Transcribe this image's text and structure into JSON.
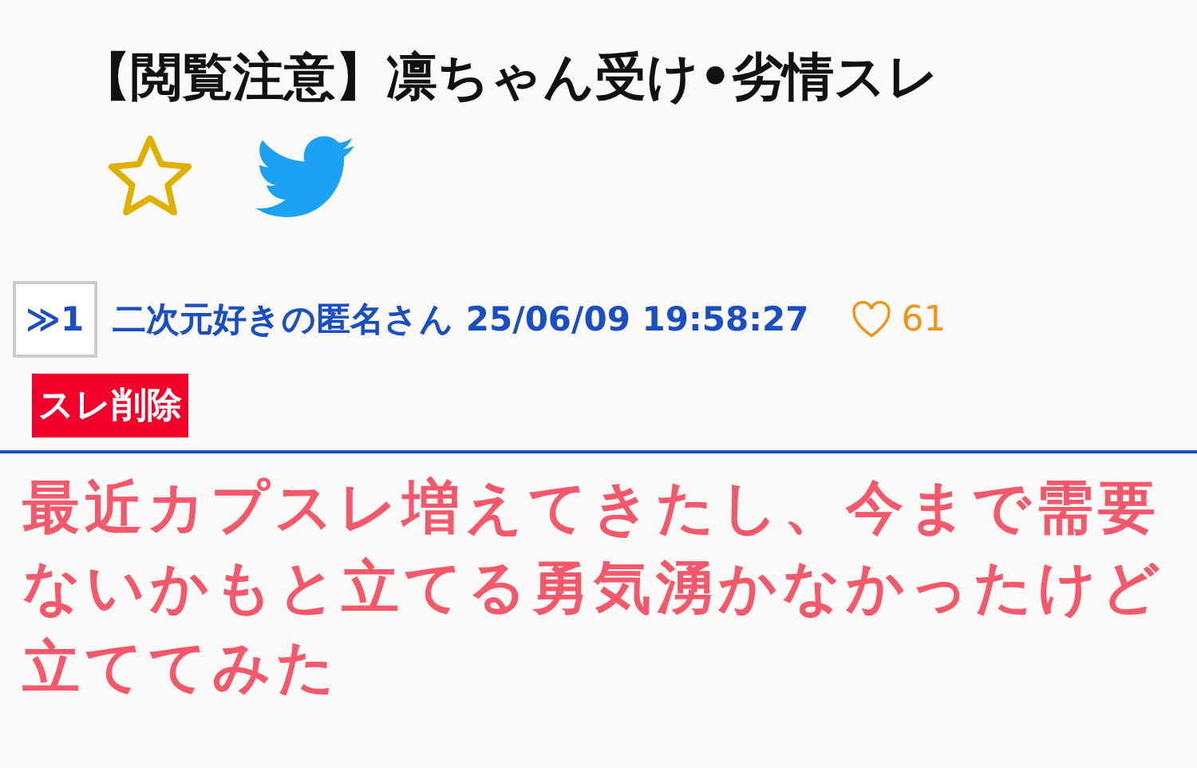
{
  "thread": {
    "title": "【閲覧注意】凛ちゃん受け•劣情スレ",
    "favorite": false
  },
  "post": {
    "number": "≫1",
    "author": "二次元好きの匿名さん",
    "datetime": "25/06/09 19:58:27",
    "likes": "61",
    "liked": false,
    "delete_label": "スレ削除",
    "body": "最近カプスレ増えてきたし、今まで需要ないかもと立てる勇気湧かなかったけど立ててみた"
  }
}
